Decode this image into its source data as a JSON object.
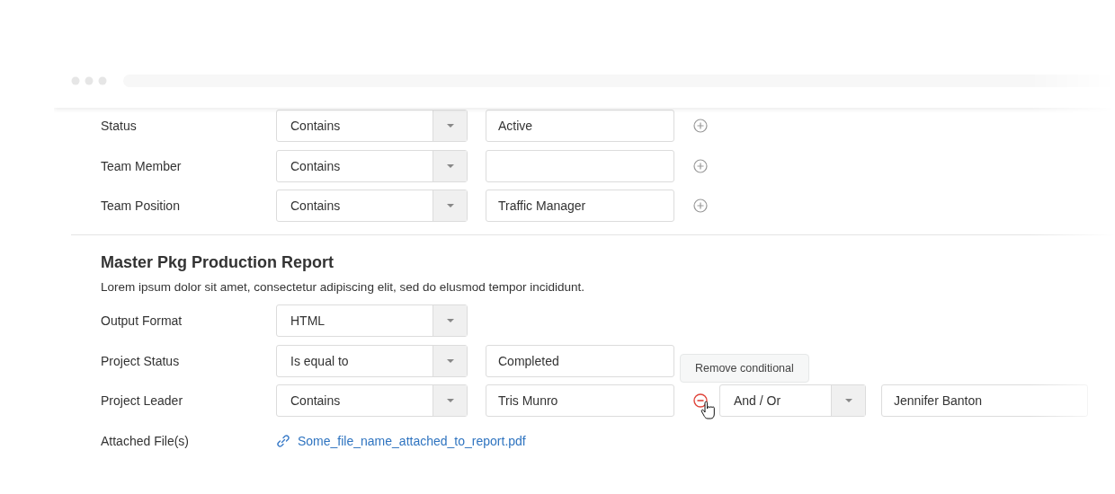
{
  "sections": [
    {
      "rows": [
        {
          "kind": "condition",
          "label": "Status",
          "operator": "Contains",
          "value": "Active",
          "action": {
            "kind": "add"
          }
        },
        {
          "kind": "condition",
          "label": "Team Member",
          "operator": "Contains",
          "action": {
            "kind": "add"
          }
        },
        {
          "kind": "condition",
          "label": "Team Position",
          "operator": "Contains",
          "value": "Traffic Manager",
          "action": {
            "kind": "add"
          }
        }
      ]
    },
    {
      "title": "Master Pkg Production Report",
      "description": "Lorem ipsum dolor sit amet, consectetur adipiscing elit, sed do elusmod tempor incididunt.",
      "rows": [
        {
          "kind": "select",
          "label": "Output Format",
          "operator": "HTML"
        },
        {
          "kind": "condition",
          "label": "Project Status",
          "operator": "Is equal to",
          "value": "Completed"
        },
        {
          "kind": "condition",
          "label": "Project Leader",
          "operator": "Contains",
          "value": "Tris Munro",
          "action": {
            "kind": "remove"
          },
          "tooltip": "Remove conditional",
          "extra": {
            "operator": "And / Or",
            "value": "Jennifer Banton"
          }
        },
        {
          "kind": "file",
          "label": "Attached File(s)",
          "file": "Some_file_name_attached_to_report.pdf"
        }
      ]
    }
  ]
}
